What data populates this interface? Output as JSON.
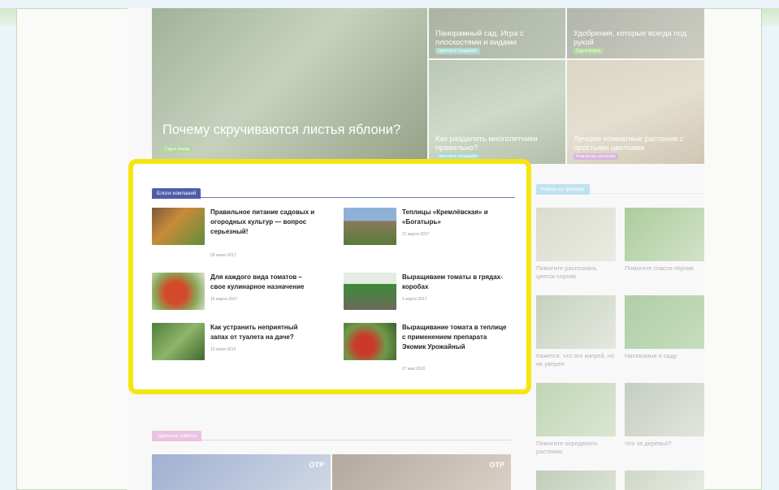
{
  "hero": {
    "main": {
      "title": "Почему скручиваются листья яблони?",
      "tag": "Сад и огород"
    },
    "tiles": [
      {
        "title": "Панорамный сад. Игра с плоскостями и видами",
        "tag": "Цветник и ландшафт"
      },
      {
        "title": "Удобрения, которые всегда под рукой",
        "tag": "Сад и огород"
      },
      {
        "title": "Как разделять многолетники правильно?",
        "tag": "Цветник и ландшафт"
      },
      {
        "title": "Лучшие комнатные растения с простыми цветками",
        "tag": "Комнатные растения"
      }
    ]
  },
  "blogs": {
    "header": "Блоги компаний",
    "items": [
      {
        "title": "Правильное питание садовых и огородных культур — вопрос серьезный!",
        "date": "28 июня 2017"
      },
      {
        "title": "Теплицы «Кремлёвская» и «Богатырь»",
        "date": "21 марта 2017"
      },
      {
        "title": "Для каждого вида томатов – свое кулинарное назначение",
        "date": "16 марта 2017"
      },
      {
        "title": "Выращиваем томаты в грядах-коробах",
        "date": "1 марта 2017"
      },
      {
        "title": "Как устранить неприятный запах от туалета на даче?",
        "date": "10 июня 2016"
      },
      {
        "title": "Выращивание томата в теплице с применением препарата Экомик Урожайный",
        "date": "27 мая 2016"
      }
    ]
  },
  "forum": {
    "header": "Новое на форуме",
    "items": [
      {
        "caption": "Помогите распознать цветок-сорняк"
      },
      {
        "caption": "Помогите спасти перчик"
      },
      {
        "caption": "Кажется, что это кипрей, но не уверен"
      },
      {
        "caption": "Насекомые в саду"
      },
      {
        "caption": "Помогите определить растения"
      },
      {
        "caption": "Что за деревья?"
      }
    ]
  },
  "tips": {
    "header": "Удачные советы",
    "logo": "ОТР"
  },
  "colors": {
    "highlight": "#f5e60f",
    "blogs_tag": "#4e5caa",
    "forum_tag": "#9bd3e8",
    "tips_tag": "#e2a0d1"
  }
}
